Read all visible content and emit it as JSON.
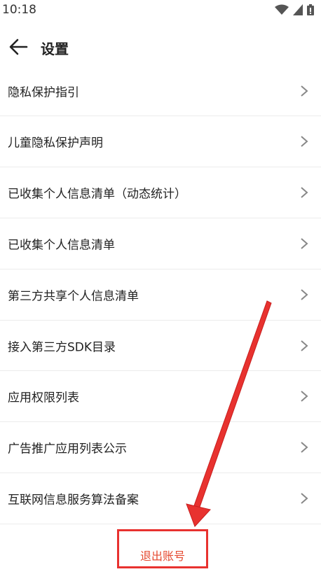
{
  "status_bar": {
    "time": "10:18"
  },
  "header": {
    "title": "设置",
    "back_icon": "back-arrow-icon"
  },
  "settings_items": [
    {
      "label": "隐私保护指引"
    },
    {
      "label": "儿童隐私保护声明"
    },
    {
      "label": "已收集个人信息清单（动态统计）"
    },
    {
      "label": "已收集个人信息清单"
    },
    {
      "label": "第三方共享个人信息清单"
    },
    {
      "label": "接入第三方SDK目录"
    },
    {
      "label": "应用权限列表"
    },
    {
      "label": "广告推广应用列表公示"
    },
    {
      "label": "互联网信息服务算法备案"
    }
  ],
  "logout": {
    "label": "退出账号"
  },
  "colors": {
    "accent_red": "#e8322f",
    "logout_text": "#e5492f"
  }
}
